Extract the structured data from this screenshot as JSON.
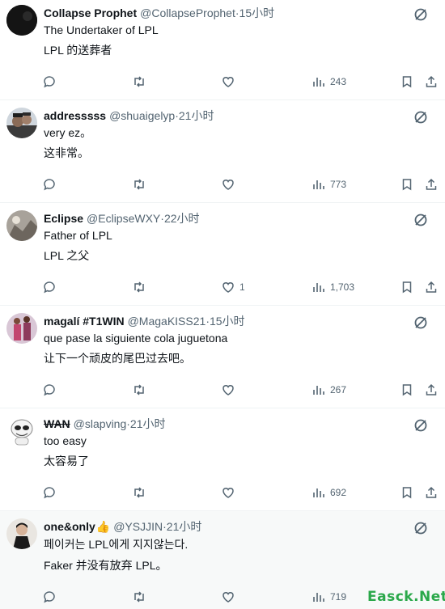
{
  "watermark": "Easck.Net",
  "posts": [
    {
      "name": "Collapse Prophet",
      "handle": "@CollapseProphet",
      "time": "15小时",
      "text1": "The Undertaker of LPL",
      "text2": "LPL 的送葬者",
      "likes": "",
      "views": "243"
    },
    {
      "name": "addresssss",
      "handle": "@shuaigelyp",
      "time": "21小时",
      "text1": "very ez。",
      "text2": "这非常。",
      "likes": "",
      "views": "773"
    },
    {
      "name": "Eclipse",
      "handle": "@EclipseWXY",
      "time": "22小时",
      "text1": "Father of LPL",
      "text2": "LPL 之父",
      "likes": "1",
      "views": "1,703"
    },
    {
      "name": "magalí #T1WIN",
      "handle": "@MagaKISS21",
      "time": "15小时",
      "text1": "que pase la siguiente cola juguetona",
      "text2": "让下一个顽皮的尾巴过去吧。",
      "likes": "",
      "views": "267"
    },
    {
      "name": "WAN",
      "handle": "@slapving",
      "time": "21小时",
      "text1": "too easy",
      "text2": "太容易了",
      "likes": "",
      "views": "692"
    },
    {
      "name": "one&only",
      "name_suffix": "👍",
      "handle": "@YSJJIN",
      "time": "21小时",
      "text1": "페이커는 LPL에게 지지않는다.",
      "text2": "Faker 并没有放弃 LPL。",
      "likes": "",
      "views": "719"
    }
  ],
  "separator": " · "
}
